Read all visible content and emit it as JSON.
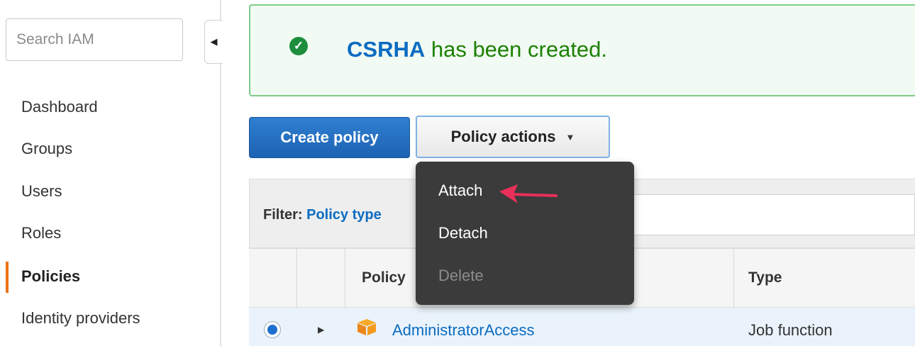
{
  "sidebar": {
    "search_placeholder": "Search IAM",
    "items": [
      {
        "label": "Dashboard"
      },
      {
        "label": "Groups"
      },
      {
        "label": "Users"
      },
      {
        "label": "Roles"
      },
      {
        "label": "Policies"
      },
      {
        "label": "Identity providers"
      }
    ],
    "active_item": "Policies"
  },
  "banner": {
    "name": "CSRHA",
    "message": " has been created."
  },
  "toolbar": {
    "create_label": "Create policy",
    "actions_label": "Policy actions"
  },
  "menu": {
    "items": [
      {
        "label": "Attach",
        "enabled": true
      },
      {
        "label": "Detach",
        "enabled": true
      },
      {
        "label": "Delete",
        "enabled": false
      }
    ]
  },
  "filter": {
    "label": "Filter:",
    "link": "Policy type"
  },
  "table": {
    "headers": {
      "policy": "Policy",
      "type": "Type"
    },
    "rows": [
      {
        "name": "AdministratorAccess",
        "type": "Job function",
        "selected": true
      }
    ]
  },
  "colors": {
    "accent": "#ec7211",
    "primary": "#1e62b3",
    "link": "#0b6cc2",
    "success": "#1d8102",
    "menu_bg": "#3b3b3b",
    "arrow": "#e8305a"
  },
  "icons": {
    "search": "none",
    "collapse": "triangle-left-icon",
    "success": "check-circle-icon",
    "dropdown": "caret-down-icon",
    "expand": "triangle-right-icon",
    "policy": "aws-policy-cube-icon",
    "annotation": "pink-arrow-icon"
  }
}
